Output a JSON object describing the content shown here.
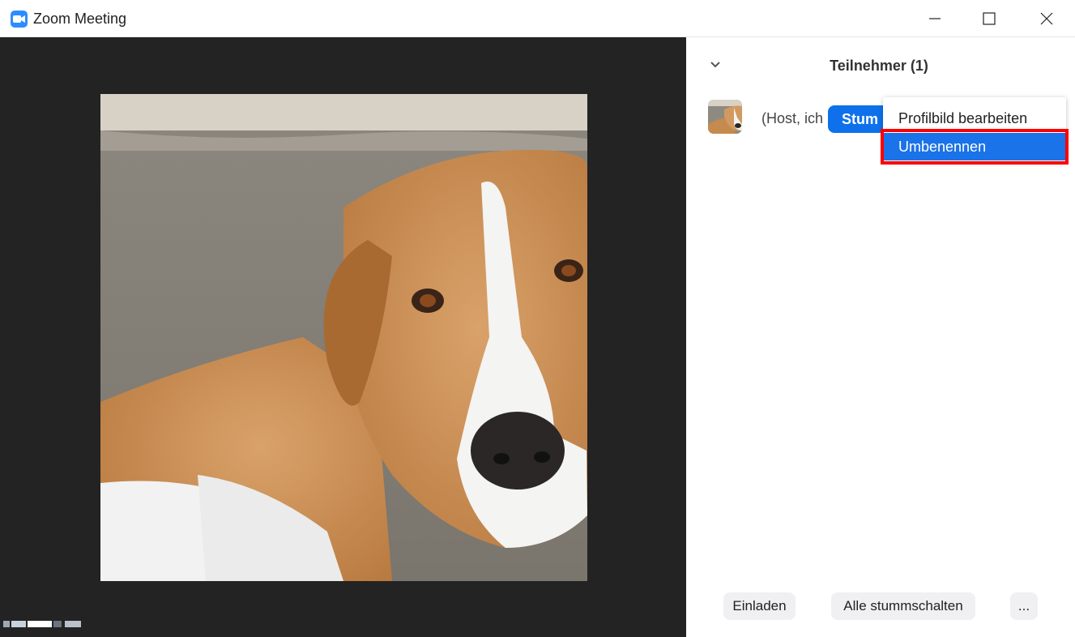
{
  "window": {
    "title": "Zoom Meeting"
  },
  "participants_panel": {
    "title": "Teilnehmer (1)",
    "participant": {
      "name_visible": "(Host, ich",
      "mute_button_label": "Stum"
    },
    "context_menu": {
      "items": [
        {
          "label": "Profilbild bearbeiten"
        },
        {
          "label": "Umbenennen",
          "selected": true
        }
      ]
    },
    "footer": {
      "invite_label": "Einladen",
      "mute_all_label": "Alle stummschalten",
      "more_label": "..."
    }
  },
  "colors": {
    "accent": "#0e71eb",
    "menu_selected": "#1a73e8",
    "highlight": "#ff0000",
    "video_bg": "#232323"
  },
  "icons": {
    "app": "zoom-camera-icon",
    "minimize": "minimize-icon",
    "maximize": "maximize-icon",
    "close": "close-icon",
    "collapse": "chevron-down-icon"
  }
}
